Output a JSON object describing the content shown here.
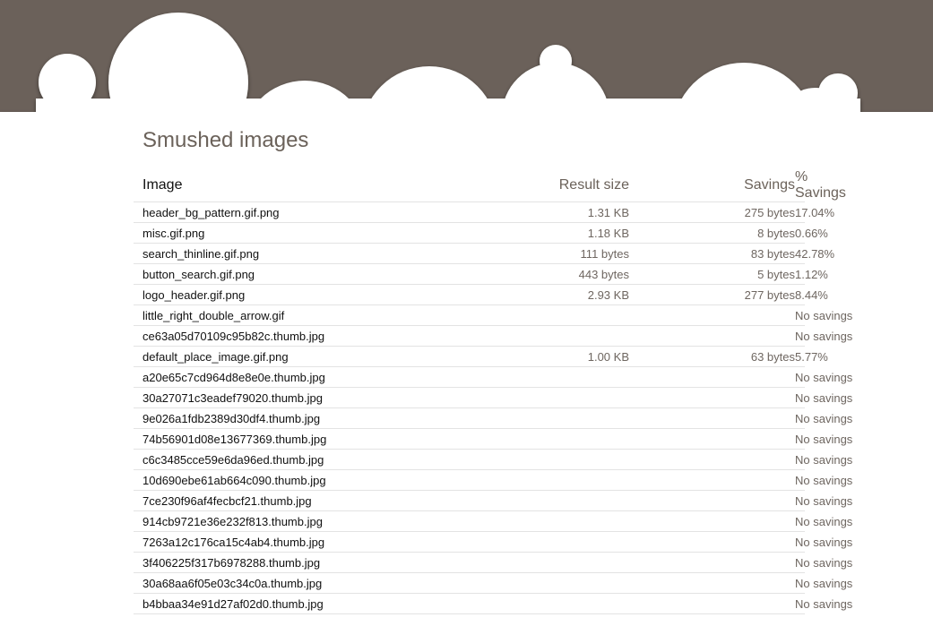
{
  "page": {
    "title": "Smushed images"
  },
  "colors": {
    "header_band": "#6b615a",
    "text_muted": "#6e6660"
  },
  "table": {
    "headers": {
      "image": "Image",
      "result_size": "Result size",
      "savings": "Savings",
      "pct_savings": "% Savings"
    },
    "rows": [
      {
        "image": "header_bg_pattern.gif.png",
        "result_size": "1.31 KB",
        "savings": "275 bytes",
        "pct_savings": "17.04%"
      },
      {
        "image": "misc.gif.png",
        "result_size": "1.18 KB",
        "savings": "8 bytes",
        "pct_savings": "0.66%"
      },
      {
        "image": "search_thinline.gif.png",
        "result_size": "111 bytes",
        "savings": "83 bytes",
        "pct_savings": "42.78%"
      },
      {
        "image": "button_search.gif.png",
        "result_size": "443 bytes",
        "savings": "5 bytes",
        "pct_savings": "1.12%"
      },
      {
        "image": "logo_header.gif.png",
        "result_size": "2.93 KB",
        "savings": "277 bytes",
        "pct_savings": "8.44%"
      },
      {
        "image": "little_right_double_arrow.gif",
        "result_size": "",
        "savings": "",
        "pct_savings": "No savings"
      },
      {
        "image": "ce63a05d70109c95b82c.thumb.jpg",
        "result_size": "",
        "savings": "",
        "pct_savings": "No savings"
      },
      {
        "image": "default_place_image.gif.png",
        "result_size": "1.00 KB",
        "savings": "63 bytes",
        "pct_savings": "5.77%"
      },
      {
        "image": "a20e65c7cd964d8e8e0e.thumb.jpg",
        "result_size": "",
        "savings": "",
        "pct_savings": "No savings"
      },
      {
        "image": "30a27071c3eadef79020.thumb.jpg",
        "result_size": "",
        "savings": "",
        "pct_savings": "No savings"
      },
      {
        "image": "9e026a1fdb2389d30df4.thumb.jpg",
        "result_size": "",
        "savings": "",
        "pct_savings": "No savings"
      },
      {
        "image": "74b56901d08e13677369.thumb.jpg",
        "result_size": "",
        "savings": "",
        "pct_savings": "No savings"
      },
      {
        "image": "c6c3485cce59e6da96ed.thumb.jpg",
        "result_size": "",
        "savings": "",
        "pct_savings": "No savings"
      },
      {
        "image": "10d690ebe61ab664c090.thumb.jpg",
        "result_size": "",
        "savings": "",
        "pct_savings": "No savings"
      },
      {
        "image": "7ce230f96af4fecbcf21.thumb.jpg",
        "result_size": "",
        "savings": "",
        "pct_savings": "No savings"
      },
      {
        "image": "914cb9721e36e232f813.thumb.jpg",
        "result_size": "",
        "savings": "",
        "pct_savings": "No savings"
      },
      {
        "image": "7263a12c176ca15c4ab4.thumb.jpg",
        "result_size": "",
        "savings": "",
        "pct_savings": "No savings"
      },
      {
        "image": "3f406225f317b6978288.thumb.jpg",
        "result_size": "",
        "savings": "",
        "pct_savings": "No savings"
      },
      {
        "image": "30a68aa6f05e03c34c0a.thumb.jpg",
        "result_size": "",
        "savings": "",
        "pct_savings": "No savings"
      },
      {
        "image": "b4bbaa34e91d27af02d0.thumb.jpg",
        "result_size": "",
        "savings": "",
        "pct_savings": "No savings"
      }
    ]
  }
}
